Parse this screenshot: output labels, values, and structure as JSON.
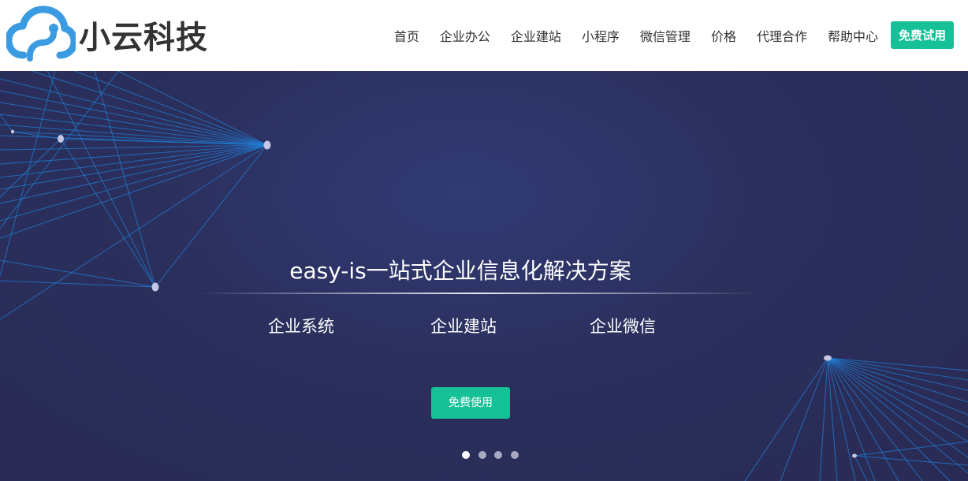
{
  "brand": {
    "name": "小云科技"
  },
  "nav": {
    "items": [
      {
        "label": "首页"
      },
      {
        "label": "企业办公"
      },
      {
        "label": "企业建站"
      },
      {
        "label": "小程序"
      },
      {
        "label": "微信管理"
      },
      {
        "label": "价格"
      },
      {
        "label": "代理合作"
      },
      {
        "label": "帮助中心"
      }
    ],
    "cta_label": "免费试用"
  },
  "hero": {
    "title": "easy-is一站式企业信息化解决方案",
    "features": [
      "企业系统",
      "企业建站",
      "企业微信"
    ],
    "button_label": "免费使用"
  },
  "carousel": {
    "slide_count": 4,
    "active_index": 0
  },
  "colors": {
    "accent": "#16c198",
    "hero_background": "#2b2f5c",
    "logo_blue": "#3a9be0",
    "text_dark": "#333333"
  }
}
